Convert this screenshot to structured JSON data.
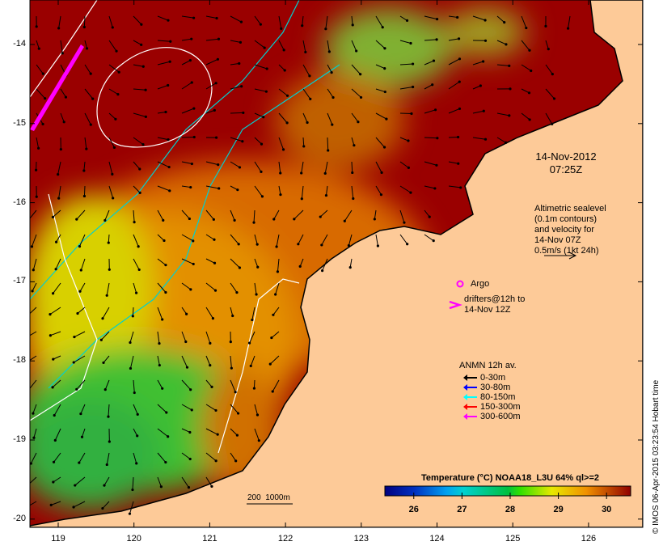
{
  "map": {
    "x_ticks": [
      "119",
      "120",
      "121",
      "122",
      "123",
      "124",
      "125",
      "126"
    ],
    "y_ticks": [
      "-14",
      "-15",
      "-16",
      "-17",
      "-18",
      "-19",
      "-20"
    ],
    "colors": {
      "land": "#FDCA98",
      "sea_hot": "#9A0000",
      "sea_warm": "#E07A00",
      "sea_mid": "#D8C800",
      "sea_cool": "#3CC43C",
      "contour": "#ffffff",
      "isobath": "#00D0D0",
      "drifter": "#FF00FF"
    }
  },
  "annotation": {
    "date": "14-Nov-2012",
    "time": "07:25Z"
  },
  "altimetry_note": [
    "Altimetric sealevel",
    "(0.1m contours)",
    "and velocity for",
    "14-Nov 07Z",
    "0.5m/s (1kt 24h)"
  ],
  "argo_label": "Argo",
  "drifters_label": [
    "drifters@12h to",
    "14-Nov 12Z"
  ],
  "anmn_legend": {
    "title": "ANMN 12h av.",
    "items": [
      {
        "label": "0-30m",
        "color": "#000000"
      },
      {
        "label": "30-80m",
        "color": "#0000FF"
      },
      {
        "label": "80-150m",
        "color": "#00FFFF"
      },
      {
        "label": "150-300m",
        "color": "#FF0000"
      },
      {
        "label": "300-600m",
        "color": "#FF00FF"
      }
    ]
  },
  "isobath_label": "200  1000m",
  "colorbar": {
    "title": "Temperature (°C) NOAA18_L3U 64% ql>=2",
    "ticks": [
      "26",
      "27",
      "28",
      "29",
      "30"
    ],
    "range": [
      25.4,
      30.5
    ]
  },
  "credit": "© IMOS 06-Apr-2015 03:23:54 Hobart time"
}
